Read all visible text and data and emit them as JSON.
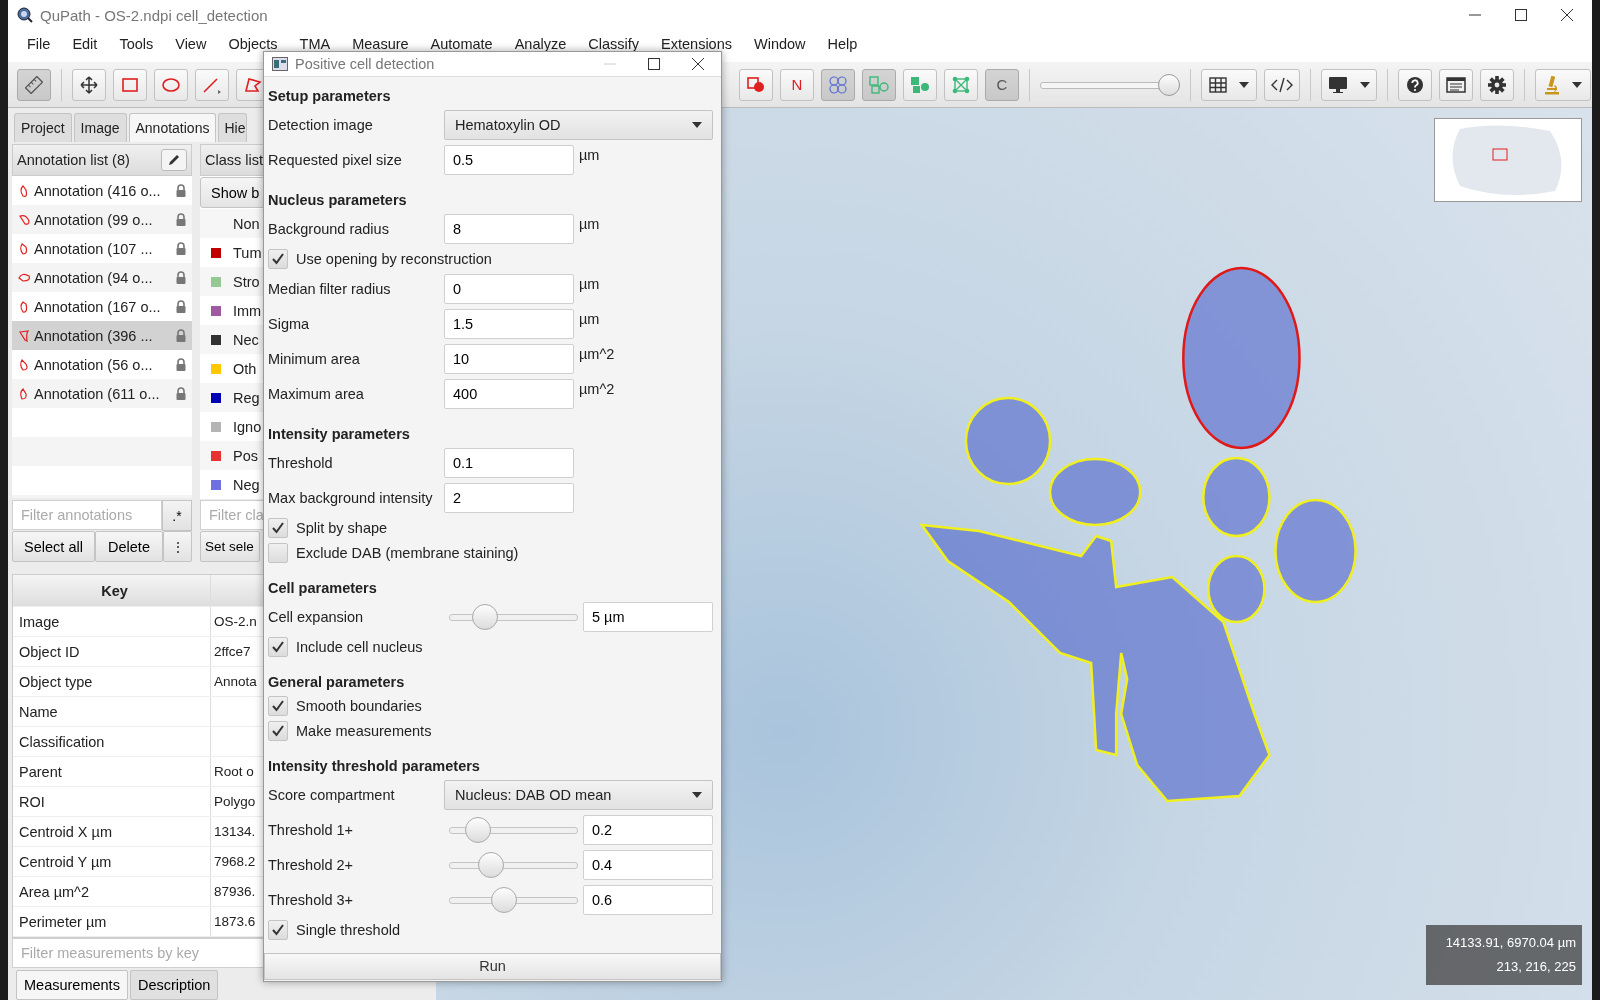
{
  "window": {
    "title": "QuPath - OS-2.ndpi cell_detection"
  },
  "menu": [
    "File",
    "Edit",
    "Tools",
    "View",
    "Objects",
    "TMA",
    "Measure",
    "Automate",
    "Analyze",
    "Classify",
    "Extensions",
    "Window",
    "Help"
  ],
  "toolbar": [
    {
      "kind": "ruler",
      "selected": true
    },
    {
      "kind": "move",
      "selected": false
    },
    {
      "kind": "rectangle",
      "selected": false
    },
    {
      "kind": "ellipse",
      "selected": false
    },
    {
      "kind": "line",
      "selected": false
    },
    {
      "kind": "polygon",
      "selected": false
    },
    {
      "kind": "shapes",
      "selected": false
    },
    {
      "kind": "text",
      "label": "N",
      "selected": false
    },
    {
      "kind": "cells",
      "selected": true
    },
    {
      "kind": "detections",
      "selected": true
    },
    {
      "kind": "detections-fill",
      "selected": false
    },
    {
      "kind": "grid",
      "selected": false
    },
    {
      "kind": "text",
      "label": "C",
      "selected": true
    },
    {
      "kind": "slider",
      "level": 1
    },
    {
      "kind": "table-menu"
    },
    {
      "kind": "code"
    },
    {
      "kind": "monitor-menu"
    },
    {
      "kind": "help"
    },
    {
      "kind": "log"
    },
    {
      "kind": "settings"
    },
    {
      "kind": "microscope-menu"
    }
  ],
  "left_panel": {
    "tabs": [
      {
        "label": "Project",
        "selected": false
      },
      {
        "label": "Image",
        "selected": false
      },
      {
        "label": "Annotations",
        "selected": true
      },
      {
        "label": "Hie",
        "selected": false
      }
    ],
    "annotation_list": {
      "title": "Annotation list (8)",
      "items": [
        {
          "label": "Annotation (416 o...",
          "selected": false
        },
        {
          "label": "Annotation (99 o...",
          "selected": false
        },
        {
          "label": "Annotation (107 ...",
          "selected": false
        },
        {
          "label": "Annotation (94 o...",
          "selected": false
        },
        {
          "label": "Annotation (167 o...",
          "selected": false
        },
        {
          "label": "Annotation (396 ...",
          "selected": true
        },
        {
          "label": "Annotation (56 o...",
          "selected": false
        },
        {
          "label": "Annotation (611 o...",
          "selected": false
        }
      ],
      "filter_placeholder": "Filter annotations",
      "regex_button": ".*",
      "buttons": [
        "Select all",
        "Delete",
        "⋮"
      ]
    },
    "class_list": {
      "title": "Class list",
      "show_button": "Show b",
      "items": [
        {
          "label": "Non"
        },
        {
          "label": "Tum",
          "color": "#c00000"
        },
        {
          "label": "Stro",
          "color": "#96c896"
        },
        {
          "label": "Imm",
          "color": "#a05aa0"
        },
        {
          "label": "Nec",
          "color": "#323232"
        },
        {
          "label": "Oth",
          "color": "#ffc800"
        },
        {
          "label": "Reg",
          "color": "#0000b4"
        },
        {
          "label": "Igno",
          "color": "#b4b4b4"
        },
        {
          "label": "Pos",
          "color": "#e63232"
        },
        {
          "label": "Neg",
          "color": "#7070e0"
        }
      ],
      "filter_placeholder": "Filter cla",
      "buttons": [
        "Set sele"
      ]
    },
    "measurements": {
      "columns": [
        "Key"
      ],
      "rows": [
        {
          "key": "Image",
          "value": "OS-2.n"
        },
        {
          "key": "Object ID",
          "value": "2ffce7"
        },
        {
          "key": "Object type",
          "value": "Annota"
        },
        {
          "key": "Name"
        },
        {
          "key": "Classification"
        },
        {
          "key": "Parent",
          "value": "Root o"
        },
        {
          "key": "ROI",
          "value": "Polygo"
        },
        {
          "key": "Centroid X µm",
          "value": "13134."
        },
        {
          "key": "Centroid Y µm",
          "value": "7968.2"
        },
        {
          "key": "Area µm^2",
          "value": "87936."
        },
        {
          "key": "Perimeter µm",
          "value": "1873.6"
        }
      ],
      "filter_placeholder": "Filter measurements by key",
      "tabs": [
        {
          "label": "Measurements",
          "selected": true
        },
        {
          "label": "Description",
          "selected": false
        }
      ]
    }
  },
  "viewer": {
    "coordinates": [
      "14133.91, 6970.04 µm",
      "213, 216, 225"
    ]
  },
  "dialog": {
    "title": "Positive cell detection",
    "sections": [
      {
        "title": "Setup parameters",
        "rows": [
          {
            "kind": "dropdown",
            "label": "Detection image",
            "value": "Hematoxylin OD"
          },
          {
            "kind": "field",
            "label": "Requested pixel size",
            "value": "0.5",
            "unit": "µm"
          }
        ]
      },
      {
        "title": "Nucleus parameters",
        "rows": [
          {
            "kind": "field",
            "label": "Background radius",
            "value": "8",
            "unit": "µm"
          },
          {
            "kind": "checkbox",
            "label": "Use opening by reconstruction",
            "checked": true
          },
          {
            "kind": "field",
            "label": "Median filter radius",
            "value": "0",
            "unit": "µm"
          },
          {
            "kind": "field",
            "label": "Sigma",
            "value": "1.5",
            "unit": "µm"
          },
          {
            "kind": "field",
            "label": "Minimum area",
            "value": "10",
            "unit": "µm^2"
          },
          {
            "kind": "field",
            "label": "Maximum area",
            "value": "400",
            "unit": "µm^2"
          }
        ]
      },
      {
        "title": "Intensity parameters",
        "rows": [
          {
            "kind": "field",
            "label": "Threshold",
            "value": "0.1"
          },
          {
            "kind": "field",
            "label": "Max background intensity",
            "value": "2"
          },
          {
            "kind": "checkbox",
            "label": "Split by shape",
            "checked": true
          },
          {
            "kind": "checkbox",
            "label": "Exclude DAB (membrane staining)",
            "checked": false
          }
        ]
      },
      {
        "title": "Cell parameters",
        "rows": [
          {
            "kind": "slider",
            "label": "Cell expansion",
            "level": 0.22,
            "value": "5 µm"
          },
          {
            "kind": "checkbox",
            "label": "Include cell nucleus",
            "checked": true
          }
        ]
      },
      {
        "title": "General parameters",
        "rows": [
          {
            "kind": "checkbox",
            "label": "Smooth boundaries",
            "checked": true
          },
          {
            "kind": "checkbox",
            "label": "Make measurements",
            "checked": true
          }
        ]
      },
      {
        "title": "Intensity threshold parameters",
        "rows": [
          {
            "kind": "dropdown",
            "label": "Score compartment",
            "value": "Nucleus: DAB OD mean"
          },
          {
            "kind": "slider",
            "label": "Threshold 1+",
            "level": 0.16,
            "value": "0.2"
          },
          {
            "kind": "slider",
            "label": "Threshold 2+",
            "level": 0.28,
            "value": "0.4"
          },
          {
            "kind": "slider",
            "label": "Threshold 3+",
            "level": 0.41,
            "value": "0.6"
          },
          {
            "kind": "checkbox",
            "label": "Single threshold",
            "checked": true
          }
        ]
      }
    ],
    "run_button": "Run"
  }
}
